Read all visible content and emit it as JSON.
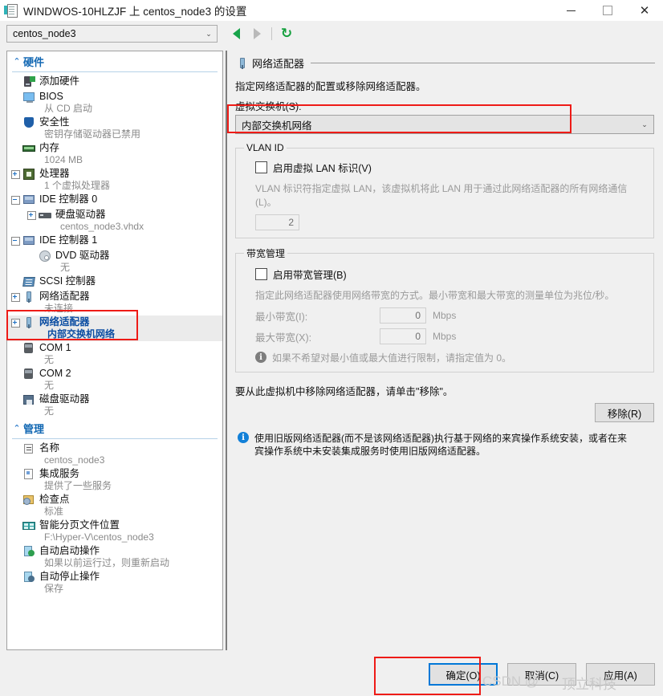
{
  "window": {
    "title": "WINDWOS-10HLZJF 上 centos_node3 的设置",
    "icon": "settings-document-icon",
    "minimize": "—",
    "maximize": "□",
    "close": "✕"
  },
  "toolbar": {
    "vm_selected": "centos_node3",
    "chevron": "⌄",
    "back_icon": "back-arrow-icon",
    "forward_icon": "forward-arrow-icon",
    "refresh_icon": "refresh-icon",
    "refresh_glyph": "↻"
  },
  "sidebar": {
    "groups": [
      {
        "title": "硬件",
        "chevron": "⌃",
        "items": [
          {
            "icon": "add-hardware-icon",
            "label": "添加硬件",
            "sub": "",
            "expander": "",
            "indent": 0,
            "selected": false
          },
          {
            "icon": "bios-monitor-icon",
            "label": "BIOS",
            "sub": "从 CD 启动",
            "expander": "",
            "indent": 0,
            "selected": false
          },
          {
            "icon": "security-shield-icon",
            "label": "安全性",
            "sub": "密钥存储驱动器已禁用",
            "expander": "",
            "indent": 0,
            "selected": false
          },
          {
            "icon": "memory-icon",
            "label": "内存",
            "sub": "1024 MB",
            "expander": "",
            "indent": 0,
            "selected": false
          },
          {
            "icon": "processor-icon",
            "label": "处理器",
            "sub": "1 个虚拟处理器",
            "expander": "plus",
            "indent": 0,
            "selected": false
          },
          {
            "icon": "ide-controller-icon",
            "label": "IDE 控制器 0",
            "sub": "",
            "expander": "minus",
            "indent": 0,
            "selected": false
          },
          {
            "icon": "hard-drive-icon",
            "label": "硬盘驱动器",
            "sub": "centos_node3.vhdx",
            "expander": "plus",
            "indent": 1,
            "selected": false
          },
          {
            "icon": "ide-controller-icon",
            "label": "IDE 控制器 1",
            "sub": "",
            "expander": "minus",
            "indent": 0,
            "selected": false
          },
          {
            "icon": "dvd-drive-icon",
            "label": "DVD 驱动器",
            "sub": "无",
            "expander": "",
            "indent": 1,
            "selected": false
          },
          {
            "icon": "scsi-controller-icon",
            "label": "SCSI 控制器",
            "sub": "",
            "expander": "",
            "indent": 0,
            "selected": false
          },
          {
            "icon": "network-adapter-icon",
            "label": "网络适配器",
            "sub": "未连接",
            "expander": "plus",
            "indent": 0,
            "selected": false
          },
          {
            "icon": "network-adapter-icon",
            "label": "网络适配器",
            "sub": "内部交换机网络",
            "expander": "plus",
            "indent": 0,
            "selected": true
          },
          {
            "icon": "com-port-icon",
            "label": "COM 1",
            "sub": "无",
            "expander": "",
            "indent": 0,
            "selected": false
          },
          {
            "icon": "com-port-icon",
            "label": "COM 2",
            "sub": "无",
            "expander": "",
            "indent": 0,
            "selected": false
          },
          {
            "icon": "floppy-drive-icon",
            "label": "磁盘驱动器",
            "sub": "无",
            "expander": "",
            "indent": 0,
            "selected": false
          }
        ]
      },
      {
        "title": "管理",
        "chevron": "⌃",
        "items": [
          {
            "icon": "name-icon",
            "label": "名称",
            "sub": "centos_node3",
            "expander": "",
            "indent": 0,
            "selected": false
          },
          {
            "icon": "integration-services-icon",
            "label": "集成服务",
            "sub": "提供了一些服务",
            "expander": "",
            "indent": 0,
            "selected": false
          },
          {
            "icon": "checkpoint-icon",
            "label": "检查点",
            "sub": "标准",
            "expander": "",
            "indent": 0,
            "selected": false
          },
          {
            "icon": "smart-paging-icon",
            "label": "智能分页文件位置",
            "sub": "F:\\Hyper-V\\centos_node3",
            "expander": "",
            "indent": 0,
            "selected": false
          },
          {
            "icon": "auto-start-icon",
            "label": "自动启动操作",
            "sub": "如果以前运行过，则重新启动",
            "expander": "",
            "indent": 0,
            "selected": false
          },
          {
            "icon": "auto-stop-icon",
            "label": "自动停止操作",
            "sub": "保存",
            "expander": "",
            "indent": 0,
            "selected": false
          }
        ]
      }
    ]
  },
  "panel": {
    "header_icon": "network-adapter-icon",
    "header_title": "网络适配器",
    "description": "指定网络适配器的配置或移除网络适配器。",
    "switch_label": "虚拟交换机(S):",
    "switch_value": "内部交换机网络",
    "switch_chevron": "⌄",
    "vlan": {
      "legend": "VLAN ID",
      "checkbox_label": "启用虚拟 LAN 标识(V)",
      "checked": false,
      "hint": "VLAN 标识符指定虚拟 LAN，该虚拟机将此 LAN 用于通过此网络适配器的所有网络通信(L)。",
      "vlan_id": "2"
    },
    "bandwidth": {
      "legend": "带宽管理",
      "checkbox_label": "启用带宽管理(B)",
      "checked": false,
      "hint": "指定此网络适配器使用网络带宽的方式。最小带宽和最大带宽的测量单位为兆位/秒。",
      "min_label": "最小带宽(I):",
      "min_value": "0",
      "min_unit": "Mbps",
      "max_label": "最大带宽(X):",
      "max_value": "0",
      "max_unit": "Mbps",
      "info_icon": "info-icon",
      "info_glyph": "i",
      "info_text": "如果不希望对最小值或最大值进行限制，请指定值为 0。"
    },
    "remove_text": "要从此虚拟机中移除网络适配器，请单击\"移除\"。",
    "remove_button": "移除(R)",
    "legacy_info_icon": "info-icon",
    "legacy_info_glyph": "i",
    "legacy_info_text": "使用旧版网络适配器(而不是该网络适配器)执行基于网络的来宾操作系统安装，或者在来宾操作系统中未安装集成服务时使用旧版网络适配器。"
  },
  "footer": {
    "ok": "确定(O)",
    "cancel": "取消(C)",
    "apply": "应用(A)"
  },
  "watermark": {
    "left": "CSDN @",
    "right": "顶立科技"
  },
  "colors": {
    "accent_blue": "#0078d7",
    "annotation_red": "#ee1b17",
    "group_header": "#1268b3",
    "selected_text": "#0b4da2",
    "panel_bg": "#f0f0f0"
  }
}
